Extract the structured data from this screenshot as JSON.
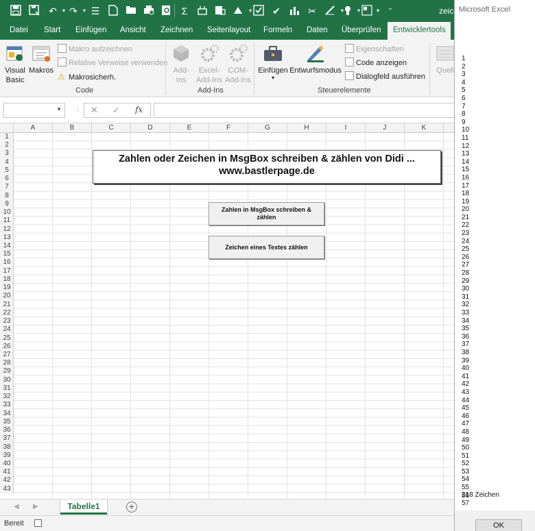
{
  "window": {
    "title_truncated": "zeic",
    "quick_access_icons": [
      "save-icon",
      "save-as-icon",
      "undo-icon",
      "redo-icon",
      "touch-mode-icon",
      "new-file-icon",
      "open-icon",
      "print-preview-icon",
      "find-icon",
      "sum-icon",
      "run-icon",
      "sheet-icon",
      "format-icon",
      "design-icon",
      "chart-icon",
      "cut-icon",
      "draw-icon",
      "touch-icon",
      "layout-icon",
      "customize-icon"
    ]
  },
  "ribbon": {
    "tabs": [
      "Datei",
      "Start",
      "Einfügen",
      "Ansicht",
      "Zeichnen",
      "Seitenlayout",
      "Formeln",
      "Daten",
      "Überprüfen",
      "Entwicklertools"
    ],
    "active_tab": "Entwicklertools",
    "code_group": {
      "label": "Code",
      "visual_basic_line1": "Visual",
      "visual_basic_line2": "Basic",
      "macros": "Makros",
      "record_macro": "Makro aufzeichnen",
      "relative_refs": "Relative Verweise verwenden",
      "macro_security": "Makrosicherh."
    },
    "addins_group": {
      "label": "Add-Ins",
      "addins_line1": "Add-",
      "addins_line2": "Ins",
      "excel_addins_line1": "Excel-",
      "excel_addins_line2": "Add-Ins",
      "com_addins_line1": "COM-",
      "com_addins_line2": "Add-Ins"
    },
    "controls_group": {
      "label": "Steuerelemente",
      "insert": "Einfügen",
      "design_mode": "Entwurfsmodus",
      "properties": "Eigenschaften",
      "view_code": "Code anzeigen",
      "run_dialog": "Dialogfeld ausführen"
    },
    "source_truncated": "Quell"
  },
  "formula_bar": {
    "namebox_value": "",
    "cancel_symbol": "✕",
    "enter_symbol": "✓",
    "fx_label": "fx",
    "formula_value": ""
  },
  "sheet": {
    "columns": [
      "A",
      "B",
      "C",
      "D",
      "E",
      "F",
      "G",
      "H",
      "I",
      "J",
      "K"
    ],
    "rows": [
      "1",
      "2",
      "3",
      "4",
      "5",
      "6",
      "7",
      "8",
      "9",
      "10",
      "11",
      "12",
      "13",
      "14",
      "15",
      "16",
      "17",
      "18",
      "19",
      "20",
      "21",
      "22",
      "23",
      "24",
      "25",
      "26",
      "27",
      "28",
      "29",
      "30",
      "31",
      "32",
      "33",
      "34",
      "35",
      "36",
      "37",
      "38",
      "39",
      "40",
      "41",
      "42",
      "43"
    ],
    "banner_line1": "Zahlen oder Zeichen in MsgBox schreiben & zählen  von Didi ...",
    "banner_line2": "www.bastlerpage.de",
    "button1_label": "Zahlen in MsgBox schreiben & zählen",
    "button2_label": "Zeichen eines Textes zählen"
  },
  "sheet_tabs": {
    "active": "Tabelle1",
    "add_symbol": "+"
  },
  "status_bar": {
    "status": "Bereit"
  },
  "msgbox": {
    "title": "Microsoft Excel",
    "lines": [
      "1",
      "2",
      "3",
      "4",
      "5",
      "6",
      "7",
      "8",
      "9",
      "10",
      "11",
      "12",
      "13",
      "14",
      "15",
      "16",
      "17",
      "18",
      "19",
      "20",
      "21",
      "22",
      "23",
      "24",
      "25",
      "26",
      "27",
      "28",
      "29",
      "30",
      "31",
      "32",
      "33",
      "34",
      "35",
      "36",
      "37",
      "38",
      "39",
      "40",
      "41",
      "42",
      "43",
      "44",
      "45",
      "46",
      "47",
      "48",
      "49",
      "50",
      "51",
      "52",
      "53",
      "54",
      "55",
      "56",
      "57"
    ],
    "count_text": "218 Zeichen",
    "ok_label": "OK"
  },
  "colors": {
    "excel_green": "#217346",
    "ribbon_bg": "#f3f3f3"
  }
}
